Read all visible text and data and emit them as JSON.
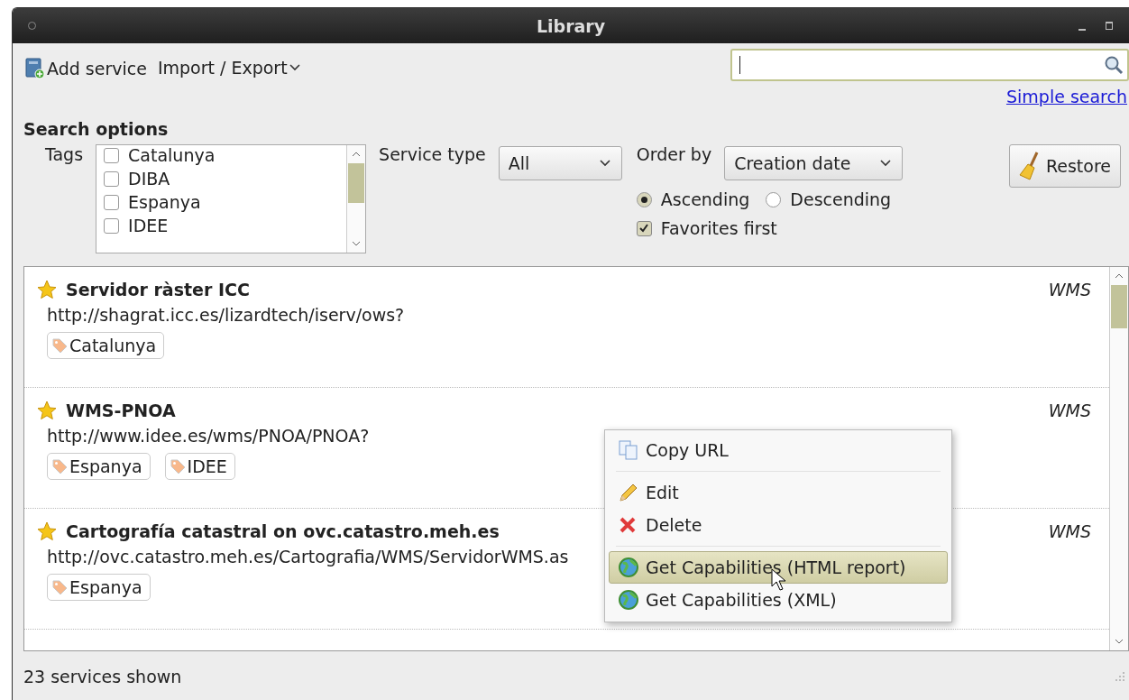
{
  "window": {
    "title": "Library"
  },
  "toolbar": {
    "add_service": "Add service",
    "import_export": "Import / Export"
  },
  "search": {
    "link": "Simple search"
  },
  "search_options": {
    "title": "Search options",
    "tags_label": "Tags",
    "tags": [
      {
        "label": "Catalunya",
        "checked": false
      },
      {
        "label": "DIBA",
        "checked": false
      },
      {
        "label": "Espanya",
        "checked": false
      },
      {
        "label": "IDEE",
        "checked": false
      }
    ],
    "service_type_label": "Service type",
    "service_type": "All",
    "order_by_label": "Order by",
    "order_by": "Creation date",
    "order": [
      {
        "label": "Ascending",
        "selected": true
      },
      {
        "label": "Descending",
        "selected": false
      }
    ],
    "favorites_first": {
      "label": "Favorites first",
      "checked": true
    },
    "restore": "Restore"
  },
  "services": [
    {
      "name": "Servidor ràster ICC",
      "url": "http://shagrat.icc.es/lizardtech/iserv/ows?",
      "type": "WMS",
      "favorite": true,
      "tags": [
        "Catalunya"
      ]
    },
    {
      "name": "WMS-PNOA",
      "url": "http://www.idee.es/wms/PNOA/PNOA?",
      "type": "WMS",
      "favorite": true,
      "tags": [
        "Espanya",
        "IDEE"
      ]
    },
    {
      "name": "Cartografía catastral on ovc.catastro.meh.es",
      "url": "http://ovc.catastro.meh.es/Cartografia/WMS/ServidorWMS.as",
      "type": "WMS",
      "favorite": true,
      "tags": [
        "Espanya"
      ]
    }
  ],
  "context_menu": [
    [
      {
        "label": "Copy URL",
        "selected": false
      }
    ],
    [
      {
        "label": "Edit",
        "selected": false
      },
      {
        "label": "Delete",
        "selected": false
      }
    ],
    [
      {
        "label": "Get Capabilities (HTML report)",
        "selected": true
      },
      {
        "label": "Get Capabilities (XML)",
        "selected": false
      }
    ]
  ],
  "status_bar": "23 services shown"
}
